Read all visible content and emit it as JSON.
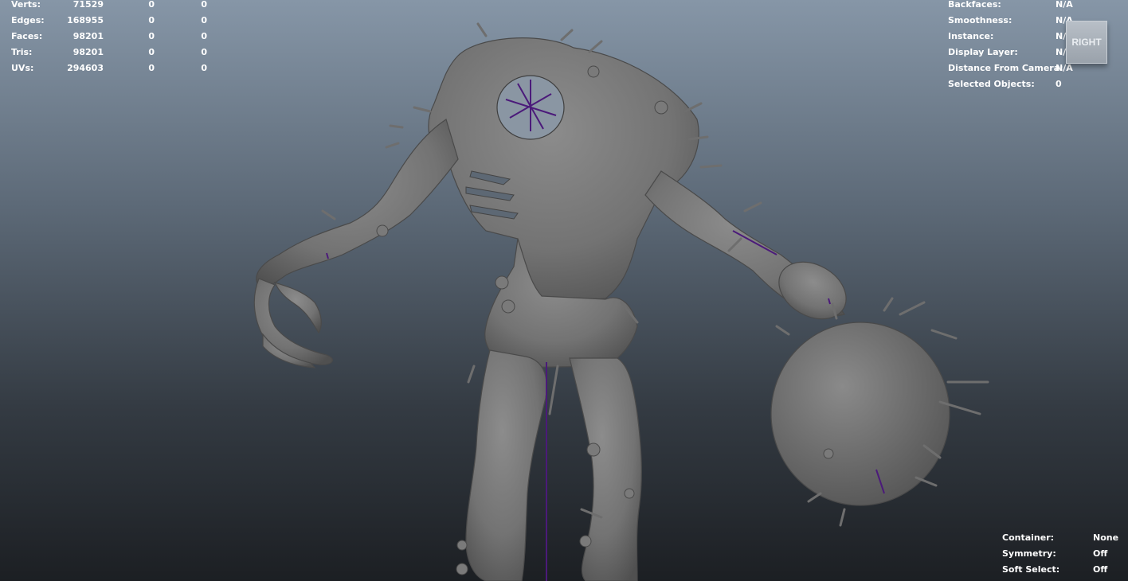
{
  "stats": {
    "rows": [
      {
        "label": "Verts:",
        "v1": "71529",
        "v2": "0",
        "v3": "0"
      },
      {
        "label": "Edges:",
        "v1": "168955",
        "v2": "0",
        "v3": "0"
      },
      {
        "label": "Faces:",
        "v1": "98201",
        "v2": "0",
        "v3": "0"
      },
      {
        "label": "Tris:",
        "v1": "98201",
        "v2": "0",
        "v3": "0"
      },
      {
        "label": "UVs:",
        "v1": "294603",
        "v2": "0",
        "v3": "0"
      }
    ]
  },
  "object_info": {
    "rows": [
      {
        "label": "Backfaces:",
        "value": "N/A"
      },
      {
        "label": "Smoothness:",
        "value": "N/A"
      },
      {
        "label": "Instance:",
        "value": "N/A"
      },
      {
        "label": "Display Layer:",
        "value": "N/A"
      },
      {
        "label": "Distance From Camera:",
        "value": "N/A"
      },
      {
        "label": "Selected Objects:",
        "value": "0"
      }
    ]
  },
  "viewcube": {
    "face_label": "RIGHT"
  },
  "tool_info": {
    "rows": [
      {
        "label": "Container:",
        "value": "None"
      },
      {
        "label": "Symmetry:",
        "value": "Off"
      },
      {
        "label": "Soft Select:",
        "value": "Off"
      }
    ]
  },
  "colors": {
    "background_top": "#8696a7",
    "background_bottom": "#1c1f23",
    "mesh": "#7d7d7d",
    "wire": "#4b1a7a",
    "hud_text": "#ffffff"
  }
}
